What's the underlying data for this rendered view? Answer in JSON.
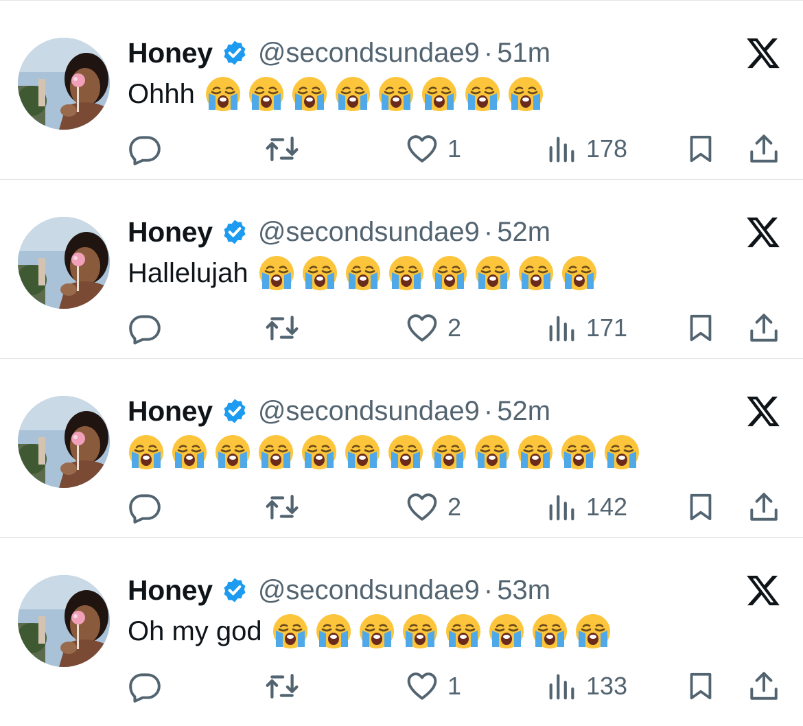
{
  "colors": {
    "text": "#0f1419",
    "secondary": "#536471",
    "verified": "#1d9bf0",
    "divider": "#e1e5e8"
  },
  "icons": {
    "reply": "reply-icon",
    "retweet": "retweet-icon",
    "like": "heart-icon",
    "views": "views-icon",
    "bookmark": "bookmark-icon",
    "share": "share-icon",
    "brand": "x-logo-icon",
    "verified": "verified-badge-icon",
    "emoji": "loudly-crying-face-emoji"
  },
  "tweets": [
    {
      "name": "Honey",
      "handle": "@secondsundae9",
      "separator": "·",
      "time": "51m",
      "text": "Ohhh",
      "emoji_count": 8,
      "likes": "1",
      "views": "178"
    },
    {
      "name": "Honey",
      "handle": "@secondsundae9",
      "separator": "·",
      "time": "52m",
      "text": "Hallelujah",
      "emoji_count": 8,
      "likes": "2",
      "views": "171"
    },
    {
      "name": "Honey",
      "handle": "@secondsundae9",
      "separator": "·",
      "time": "52m",
      "text": "",
      "emoji_count": 12,
      "likes": "2",
      "views": "142"
    },
    {
      "name": "Honey",
      "handle": "@secondsundae9",
      "separator": "·",
      "time": "53m",
      "text": "Oh my god",
      "emoji_count": 8,
      "likes": "1",
      "views": "133"
    }
  ]
}
